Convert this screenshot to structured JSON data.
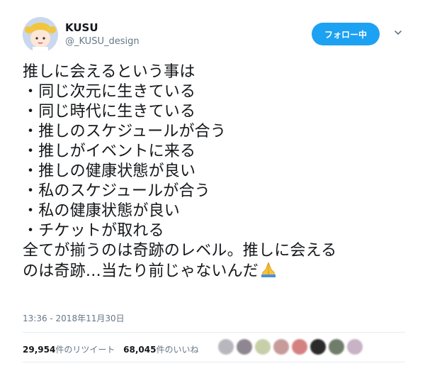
{
  "user": {
    "display_name": "KUSU",
    "handle": "@_KUSU_design"
  },
  "follow_button": {
    "label": "フォロー中"
  },
  "tweet": {
    "lines": [
      "推しに会えるという事は",
      "同じ次元に生きている",
      "同じ時代に生きている",
      "推しのスケジュールが合う",
      "推しがイベントに来る",
      "推しの健康状態が良い",
      "私のスケジュールが合う",
      "私の健康状態が良い",
      "チケットが取れる",
      "全てが揃うのは奇跡のレベル。推しに会える",
      "のは奇跡…当たり前じゃないんだ"
    ],
    "emoji": "folded-hands-emoji"
  },
  "timestamp": "13:36 - 2018年11月30日",
  "stats": {
    "retweets_count": "29,954",
    "retweets_label": "件のリツイート",
    "likes_count": "68,045",
    "likes_label": "件のいいね"
  },
  "colors": {
    "accent": "#1da1f2",
    "text": "#14171a",
    "muted": "#657786"
  }
}
